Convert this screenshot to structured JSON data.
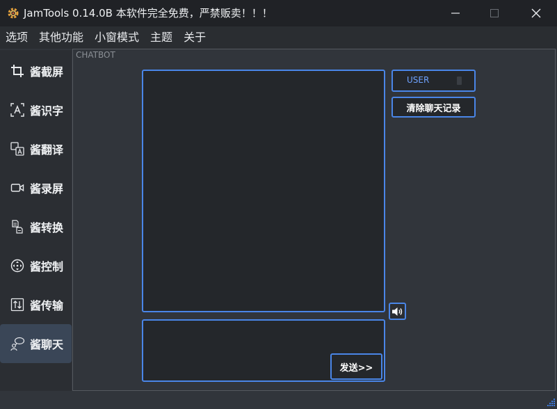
{
  "window": {
    "title": "JamTools 0.14.0B  本软件完全免费，严禁贩卖！！！",
    "minimize_icon": "minimize-icon",
    "maximize_icon": "maximize-icon",
    "close_icon": "close-icon"
  },
  "menu": {
    "items": [
      {
        "label": "选项"
      },
      {
        "label": "其他功能"
      },
      {
        "label": "小窗模式"
      },
      {
        "label": "主题"
      },
      {
        "label": "关于"
      }
    ]
  },
  "sidebar": {
    "items": [
      {
        "label": "酱截屏",
        "icon": "crop-icon"
      },
      {
        "label": "酱识字",
        "icon": "ocr-icon"
      },
      {
        "label": "酱翻译",
        "icon": "translate-icon"
      },
      {
        "label": "酱录屏",
        "icon": "video-icon"
      },
      {
        "label": "酱转换",
        "icon": "file-convert-icon"
      },
      {
        "label": "酱控制",
        "icon": "control-icon"
      },
      {
        "label": "酱传输",
        "icon": "transfer-icon"
      },
      {
        "label": "酱聊天",
        "icon": "chat-icon",
        "active": true
      }
    ]
  },
  "chatbot": {
    "panel_title": "CHATBOT",
    "user_select_value": "USER",
    "clear_button": "清除聊天记录",
    "send_button": "发送>>",
    "speaker_icon": "speaker-icon",
    "chat_history": "",
    "input_value": ""
  },
  "colors": {
    "accent": "#4a86e8",
    "titlebar": "#202226",
    "background": "#31353b",
    "active_item": "#3a4657"
  }
}
